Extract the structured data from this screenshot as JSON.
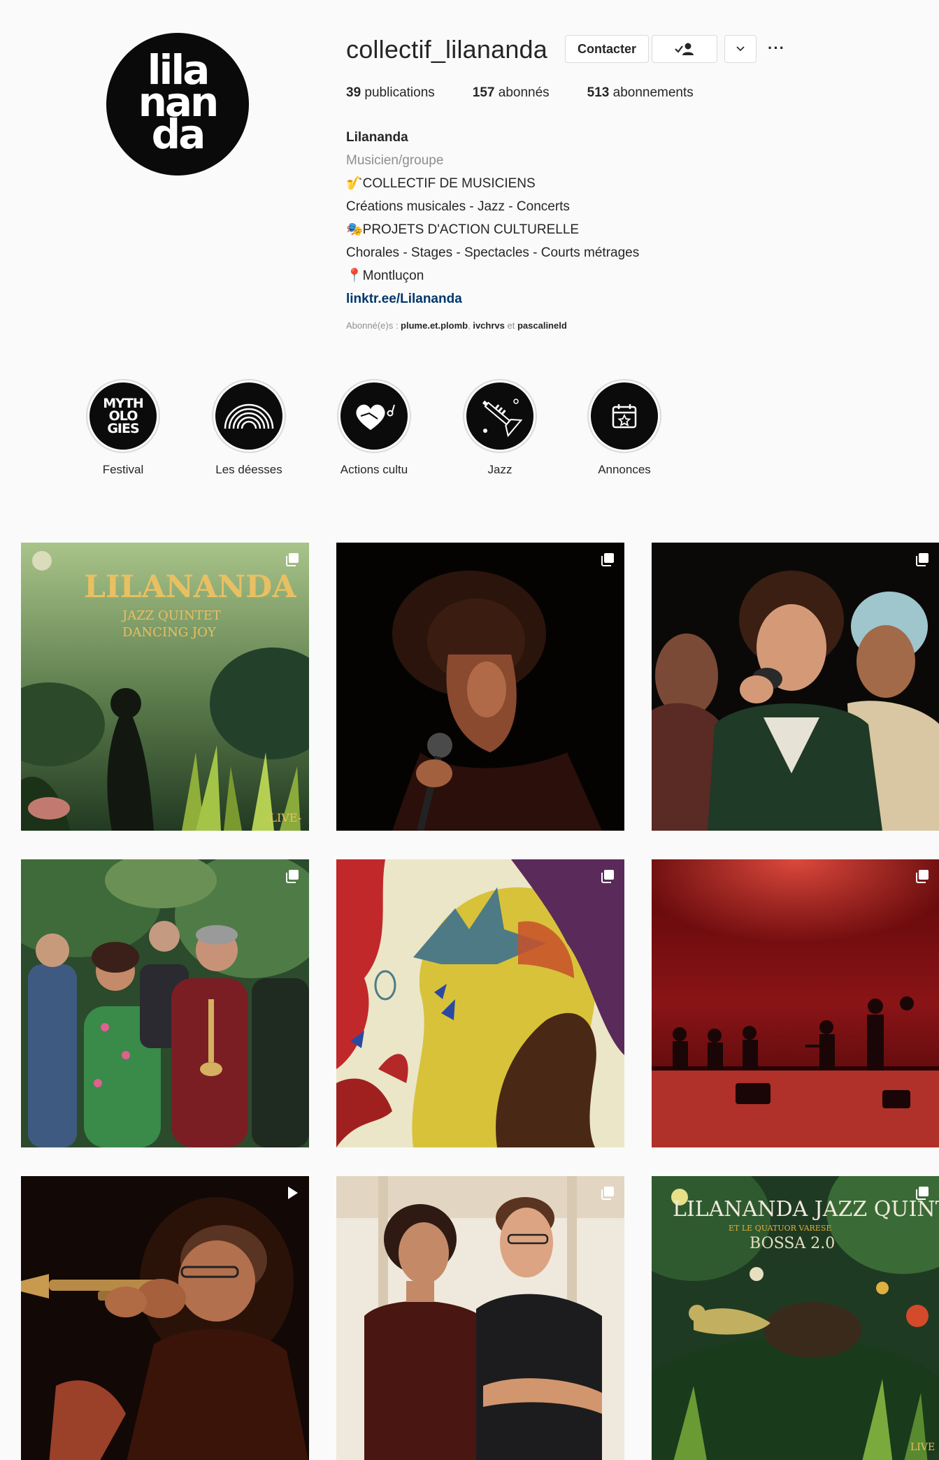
{
  "profile": {
    "username": "collectif_lilananda",
    "avatar_lines": [
      "lila",
      "nan",
      "da"
    ],
    "buttons": {
      "contact": "Contacter"
    },
    "stats": {
      "posts_count": "39",
      "posts_label": "publications",
      "followers_count": "157",
      "followers_label": "abonnés",
      "following_count": "513",
      "following_label": "abonnements"
    },
    "bio": {
      "name": "Lilananda",
      "category": "Musicien/groupe",
      "line1": "🎷COLLECTIF DE MUSICIENS",
      "line2": "Créations musicales - Jazz - Concerts",
      "line3": "🎭PROJETS D'ACTION CULTURELLE",
      "line4": "Chorales - Stages - Spectacles - Courts métrages",
      "line5": "📍Montluçon",
      "link": "linktr.ee/Lilananda"
    },
    "followed_by": {
      "prefix": "Abonné(e)s : ",
      "user1": "plume.et.plomb",
      "user2": "ivchrvs",
      "separator": ", ",
      "joiner": " et ",
      "user3": "pascalineld"
    }
  },
  "highlights": [
    {
      "label": "Festival",
      "icon": "mythologies-text-icon",
      "icon_text": [
        "MYTH",
        "OLO",
        "GIES"
      ]
    },
    {
      "label": "Les déesses",
      "icon": "rainbow-arch-icon"
    },
    {
      "label": "Actions cultu",
      "icon": "heart-handshake-icon"
    },
    {
      "label": "Jazz",
      "icon": "trumpet-icon"
    },
    {
      "label": "Annonces",
      "icon": "calendar-star-icon"
    }
  ],
  "posts": [
    {
      "type": "album",
      "title": "LILANANDA",
      "subtitle1": "JAZZ QUINTET",
      "subtitle2": "DANCING JOY",
      "corner": "-LIVE-"
    },
    {
      "type": "album"
    },
    {
      "type": "album"
    },
    {
      "type": "album"
    },
    {
      "type": "album"
    },
    {
      "type": "album"
    },
    {
      "type": "video"
    },
    {
      "type": "album"
    },
    {
      "type": "album",
      "title": "LILANANDA JAZZ QUINTET",
      "subtitle1": "ET LE QUATUOR VARESE",
      "subtitle2": "BOSSA 2.0",
      "corner": "LIVE"
    }
  ],
  "colors": {
    "link": "#00376b",
    "muted": "#8e8e8e",
    "border": "#dbdbdb",
    "accent": "#d9b25a"
  }
}
